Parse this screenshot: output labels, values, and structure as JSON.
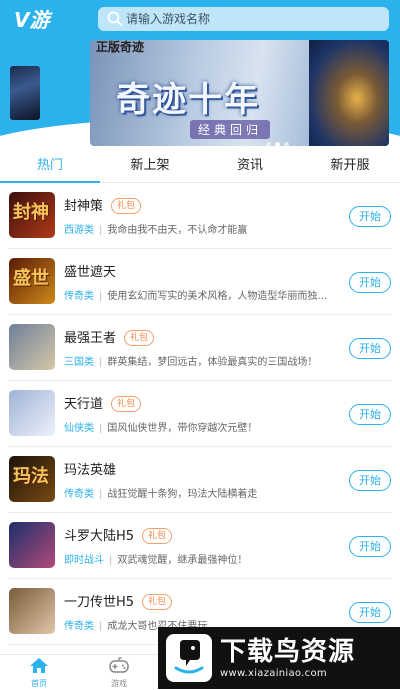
{
  "header": {
    "logo": "V游",
    "search_placeholder": "请输入游戏名称",
    "search_icon": "search-icon"
  },
  "banner": {
    "corner_text": "正版奇迹",
    "title": "奇迹十年",
    "subtitle": "经典回归",
    "pages": 3,
    "active_page": 1
  },
  "tabs": [
    {
      "label": "热门",
      "active": true
    },
    {
      "label": "新上架",
      "active": false
    },
    {
      "label": "资讯",
      "active": false
    },
    {
      "label": "新开服",
      "active": false
    }
  ],
  "games": [
    {
      "name": "封神策",
      "badge": "礼包",
      "category": "西游类",
      "desc": "我命由我不由天，不认命才能赢",
      "action": "开始",
      "thumb_glyph": "封神",
      "thumb_colors": [
        "#3b0f0f",
        "#b03a16"
      ]
    },
    {
      "name": "盛世遮天",
      "badge": "",
      "category": "传奇类",
      "desc": "使用玄幻而写实的美术风格，人物造型华丽而独特，富…",
      "action": "开始",
      "thumb_glyph": "盛世",
      "thumb_colors": [
        "#5a1a05",
        "#d08a1a"
      ]
    },
    {
      "name": "最强王者",
      "badge": "礼包",
      "category": "三国类",
      "desc": "群英集结，梦回远古，体验最真实的三国战场！",
      "action": "开始",
      "thumb_glyph": "",
      "thumb_colors": [
        "#6d7f99",
        "#d7c7a8"
      ]
    },
    {
      "name": "天行道",
      "badge": "礼包",
      "category": "仙侠类",
      "desc": "国风仙侠世界，带你穿越次元壁！",
      "action": "开始",
      "thumb_glyph": "",
      "thumb_colors": [
        "#9fb2d6",
        "#eef2fb"
      ]
    },
    {
      "name": "玛法英雄",
      "badge": "",
      "category": "传奇类",
      "desc": "战狂觉醒十条狗，玛法大陆横着走",
      "action": "开始",
      "thumb_glyph": "玛法",
      "thumb_colors": [
        "#1a120a",
        "#7a4a12"
      ]
    },
    {
      "name": "斗罗大陆H5",
      "badge": "礼包",
      "category": "即时战斗",
      "desc": "双武魂觉醒，继承最强神位！",
      "action": "开始",
      "thumb_glyph": "",
      "thumb_colors": [
        "#1c2f6b",
        "#b24a7a"
      ]
    },
    {
      "name": "一刀传世H5",
      "badge": "礼包",
      "category": "传奇类",
      "desc": "成龙大哥也忍不住要玩",
      "action": "开始",
      "thumb_glyph": "",
      "thumb_colors": [
        "#7a5a3a",
        "#e0c7a8"
      ]
    }
  ],
  "bottom_nav": [
    {
      "label": "首页",
      "icon": "home-icon",
      "active": true
    },
    {
      "label": "游戏",
      "icon": "gamepad-icon",
      "active": false
    }
  ],
  "watermark": {
    "title": "下载鸟资源",
    "url": "www.xiazainiao.com"
  },
  "colors": {
    "accent": "#2bb1ec",
    "badge": "#f08a4b"
  }
}
